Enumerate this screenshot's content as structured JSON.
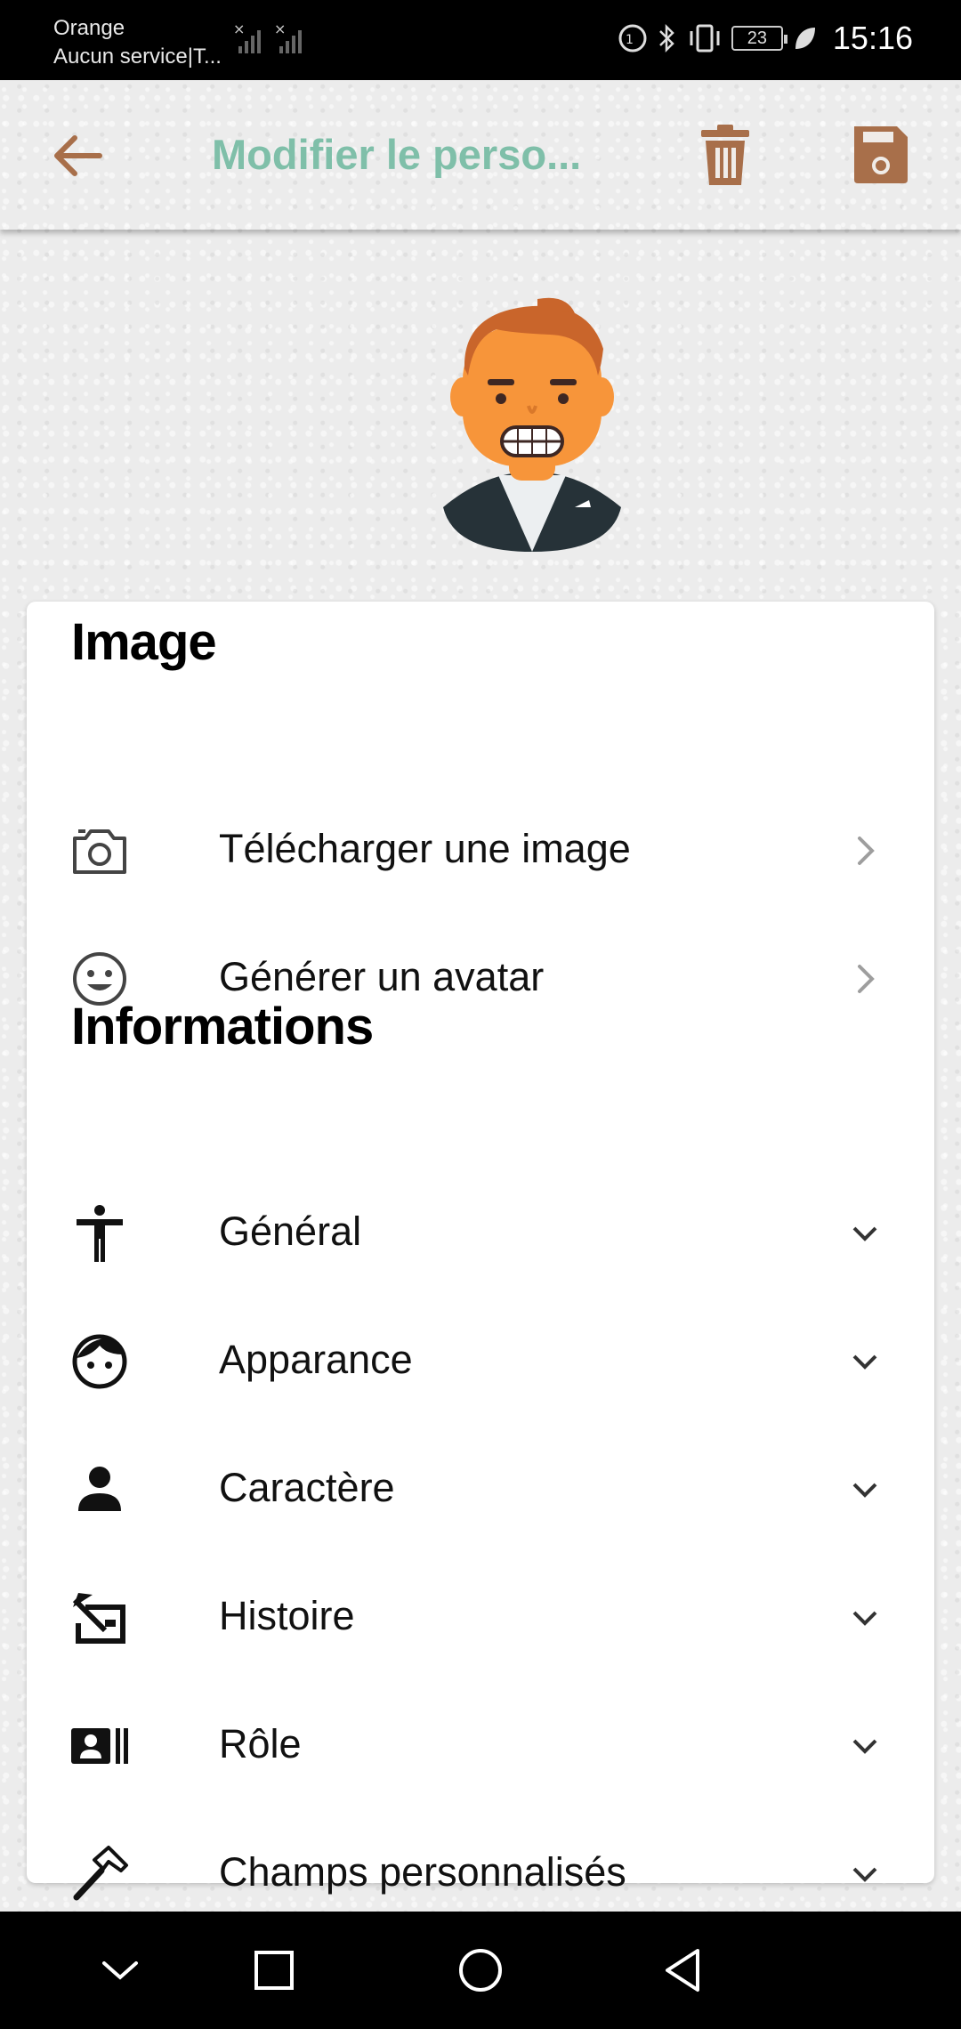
{
  "status_bar": {
    "carrier_line1": "Orange",
    "carrier_line2": "Aucun service|T...",
    "battery": "23",
    "time": "15:16"
  },
  "app_bar": {
    "title": "Modifier le perso..."
  },
  "sections": {
    "image_title": "Image",
    "info_title": "Informations"
  },
  "image_items": [
    {
      "label": "Télécharger une image",
      "icon": "camera-icon"
    },
    {
      "label": "Générer un avatar",
      "icon": "smiley-icon"
    }
  ],
  "info_items": [
    {
      "label": "Général",
      "icon": "accessibility-icon"
    },
    {
      "label": "Apparance",
      "icon": "face-icon"
    },
    {
      "label": "Caractère",
      "icon": "person-icon"
    },
    {
      "label": "Histoire",
      "icon": "history-icon"
    },
    {
      "label": "Rôle",
      "icon": "badge-icon"
    },
    {
      "label": "Champs personnalisés",
      "icon": "hammer-icon"
    }
  ],
  "colors": {
    "accent_title": "#7fbfa9",
    "action_brown": "#a86f4a"
  }
}
